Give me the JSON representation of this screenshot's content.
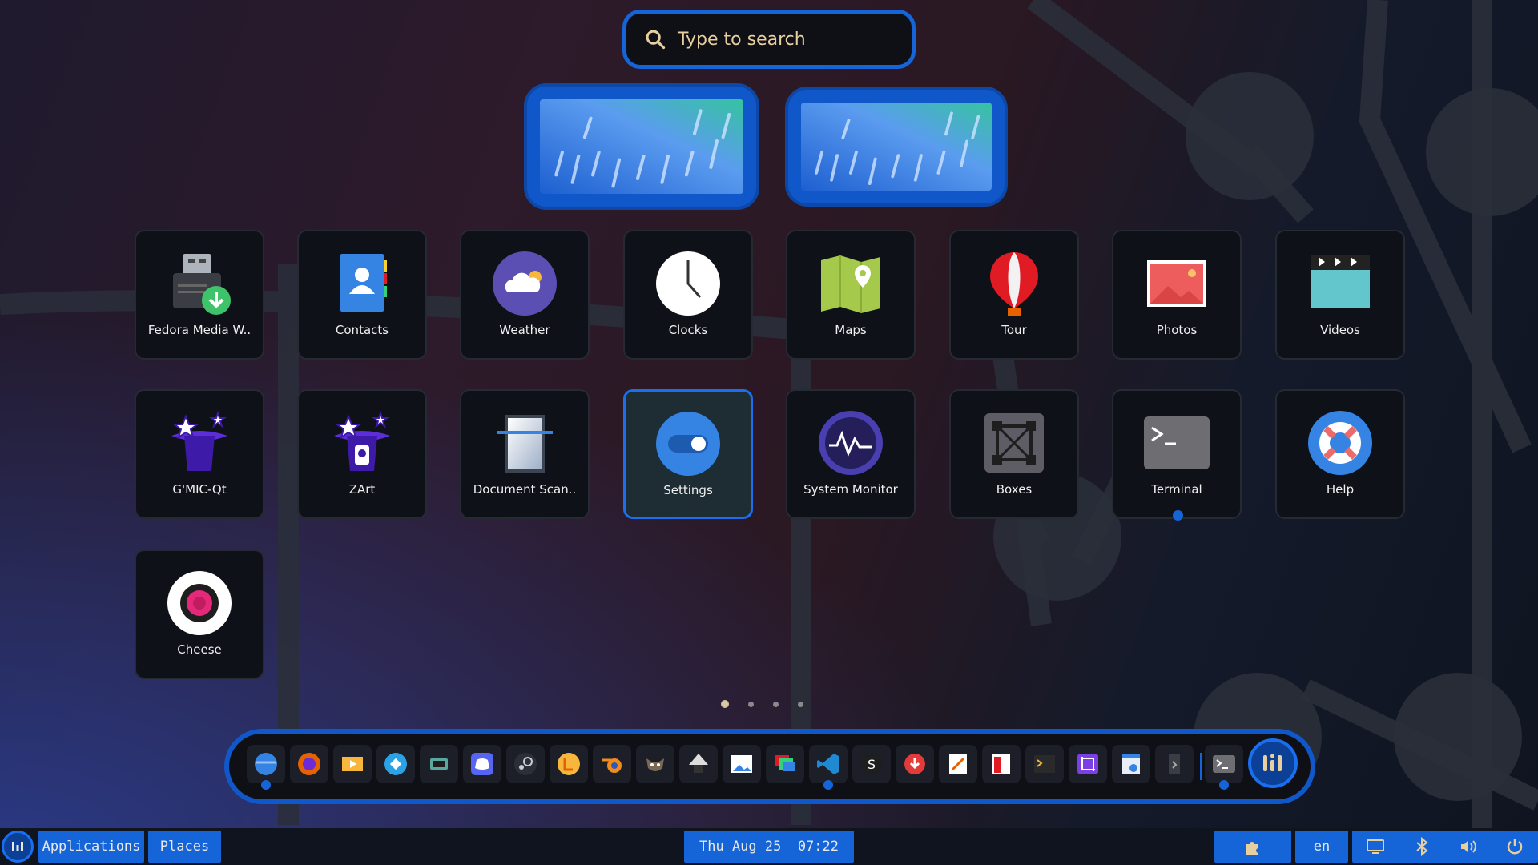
{
  "search": {
    "placeholder": "Type to search"
  },
  "apps": [
    {
      "label": "Fedora Media W..",
      "icon": "fedora-media-writer-icon"
    },
    {
      "label": "Contacts",
      "icon": "contacts-icon"
    },
    {
      "label": "Weather",
      "icon": "weather-icon"
    },
    {
      "label": "Clocks",
      "icon": "clocks-icon"
    },
    {
      "label": "Maps",
      "icon": "maps-icon"
    },
    {
      "label": "Tour",
      "icon": "tour-balloon-icon"
    },
    {
      "label": "Photos",
      "icon": "photos-icon"
    },
    {
      "label": "Videos",
      "icon": "videos-icon"
    },
    {
      "label": "G'MIC-Qt",
      "icon": "gmic-qt-icon"
    },
    {
      "label": "ZArt",
      "icon": "zart-icon"
    },
    {
      "label": "Document Scan..",
      "icon": "document-scanner-icon"
    },
    {
      "label": "Settings",
      "icon": "settings-icon",
      "selected": true
    },
    {
      "label": "System Monitor",
      "icon": "system-monitor-icon"
    },
    {
      "label": "Boxes",
      "icon": "boxes-icon"
    },
    {
      "label": "Terminal",
      "icon": "terminal-icon",
      "running": true
    },
    {
      "label": "Help",
      "icon": "help-icon"
    },
    {
      "label": "Cheese",
      "icon": "cheese-icon"
    }
  ],
  "pagination": {
    "pages": 4,
    "current": 1
  },
  "dock": {
    "items": [
      "files-icon",
      "firefox-icon",
      "media-player-icon",
      "kodi-icon",
      "vm-manager-icon",
      "discord-icon",
      "steam-icon",
      "lutris-icon",
      "blender-icon",
      "gimp-icon",
      "inkscape-icon",
      "image-viewer-icon",
      "remote-desktop-icon",
      "vscode-icon",
      "simplenote-icon",
      "downloader-icon",
      "text-editor-icon",
      "calculator-icon",
      "terminal-tools-icon",
      "screenshot-crop-icon",
      "disk-usage-icon",
      "usb-writer-icon",
      "terminal-icon"
    ],
    "running": [
      "files-icon",
      "vscode-icon",
      "terminal-icon"
    ]
  },
  "panel": {
    "applications": "Applications",
    "places": "Places",
    "clock": "Thu Aug 25  07:22",
    "keyboard_layout": "en",
    "tray_icons": [
      "extensions-icon",
      "display-icon",
      "bluetooth-icon",
      "volume-icon",
      "power-icon"
    ]
  },
  "colors": {
    "accent": "#1565d8",
    "accent_dark": "#0c3f96",
    "tile": "#0f1118"
  }
}
